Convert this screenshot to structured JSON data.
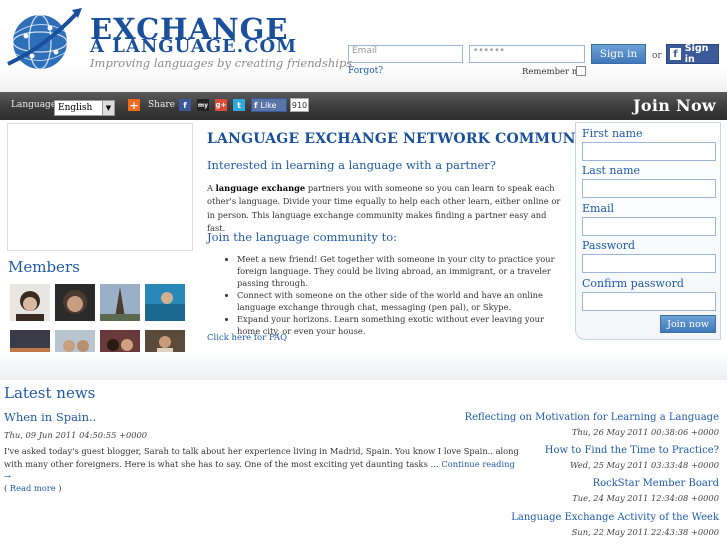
{
  "header": {
    "logo_line1": "EXCHANGE",
    "logo_line2": "A LANGUAGE.COM",
    "tagline": "Improving languages by creating friendships",
    "login": {
      "email_placeholder": "Email",
      "password_placeholder": "••••••",
      "signin_label": "Sign in",
      "or_label": "or",
      "fb_signin_label": "Sign in",
      "forgot_label": "Forgot?",
      "remember_label": "Remember me"
    }
  },
  "toolbar": {
    "language_label": "Language:",
    "language_value": "English",
    "share_label": "Share",
    "like_label": "Like",
    "like_count": "910",
    "join_now": "Join Now",
    "share_icons": [
      "facebook-icon",
      "myspace-icon",
      "google-icon",
      "twitter-icon"
    ],
    "colors": {
      "facebook": "#3b5998",
      "myspace": "#222222",
      "google": "#dd4b39",
      "twitter": "#2fa8e0",
      "addthis": "#f26b21"
    }
  },
  "members": {
    "title": "Members"
  },
  "center": {
    "title": "LANGUAGE EXCHANGE NETWORK COMMUNITY",
    "subtitle": "Interested in learning a language with a partner?",
    "para_a": "A ",
    "para_bold": "language exchange",
    "para_b": " partners you with someone so you can learn to speak each other's language. Divide your time equally to help each other learn, either online or in person. This language exchange community makes finding a partner easy and fast.",
    "join_heading": "Join the language community to:",
    "bullets": [
      "Meet a new friend! Get together with someone in your city to practice your foreign language. They could be living abroad, an immigrant, or a traveler passing through.",
      "Connect with someone on the other side of the world and have an online language exchange through chat, messaging (pen pal), or Skype.",
      "Expand your horizons. Learn something exotic without ever leaving your home city, or even your house."
    ],
    "faq": "Click here for FAQ"
  },
  "signup": {
    "first_name": "First name",
    "last_name": "Last name",
    "email": "Email",
    "password": "Password",
    "confirm_password": "Confirm password",
    "join_button": "Join now"
  },
  "news": {
    "title": "Latest news",
    "main": {
      "title": "When in Spain..",
      "date": "Thu, 09 Jun 2011 04:50:55 +0000",
      "body": "I've asked today's guest blogger, Sarah to talk about her experience living in Madrid, Spain. You know I love Spain.. along with many other foreigners. Here is what she has to say. One of the most exciting yet daunting tasks … ",
      "continue": "Continue reading →",
      "read_more": "Read more"
    },
    "side": [
      {
        "title": "Reflecting on Motivation for Learning a Language",
        "date": "Thu, 26 May 2011 00:38:06 +0000"
      },
      {
        "title": "How to Find the Time to Practice?",
        "date": "Wed, 25 May 2011 03:33:48 +0000"
      },
      {
        "title": "RockStar Member Board",
        "date": "Tue, 24 May 2011 12:34:08 +0000"
      },
      {
        "title": "Language Exchange Activity of the Week",
        "date": "Sun, 22 May 2011 22:43:38 +0000"
      }
    ]
  },
  "accent_color": "#1f5aa8"
}
